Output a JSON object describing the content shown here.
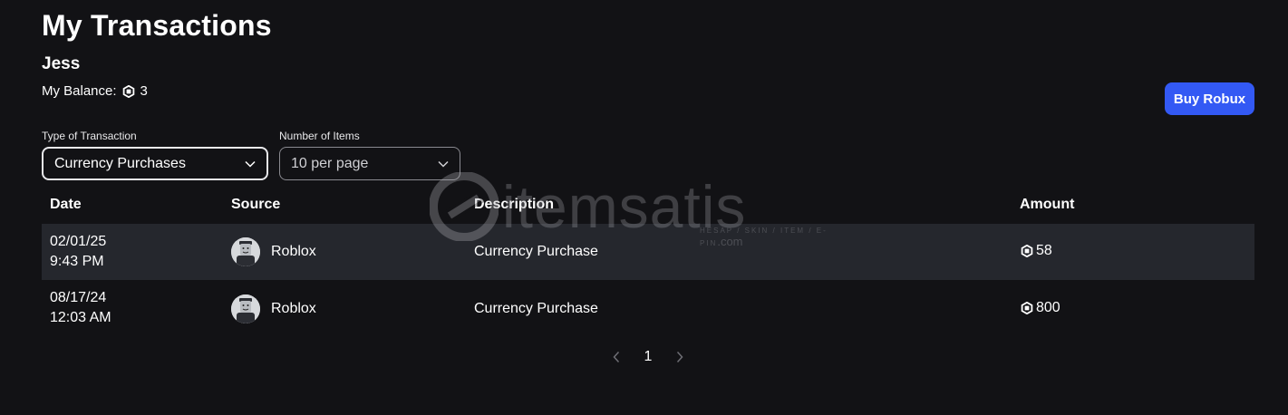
{
  "page": {
    "title": "My Transactions",
    "username": "Jess",
    "balance_label": "My Balance:",
    "balance_value": "3",
    "buy_button": "Buy Robux"
  },
  "filters": {
    "type_label": "Type of Transaction",
    "type_value": "Currency Purchases",
    "count_label": "Number of Items",
    "count_value": "10 per page"
  },
  "table": {
    "columns": [
      "Date",
      "Source",
      "Description",
      "Amount"
    ],
    "rows": [
      {
        "date": "02/01/25",
        "time": "9:43 PM",
        "source": "Roblox",
        "description": "Currency Purchase",
        "amount": "58"
      },
      {
        "date": "08/17/24",
        "time": "12:03 AM",
        "source": "Roblox",
        "description": "Currency Purchase",
        "amount": "800"
      }
    ]
  },
  "pagination": {
    "current_page": "1"
  },
  "watermark": {
    "brand": "itemsatis",
    "tagline": "HESAP / SKIN / ITEM / E-PIN",
    "suffix": ".com"
  },
  "colors": {
    "background": "#121215",
    "accent": "#3359f4",
    "row_shade": "#25272d"
  }
}
